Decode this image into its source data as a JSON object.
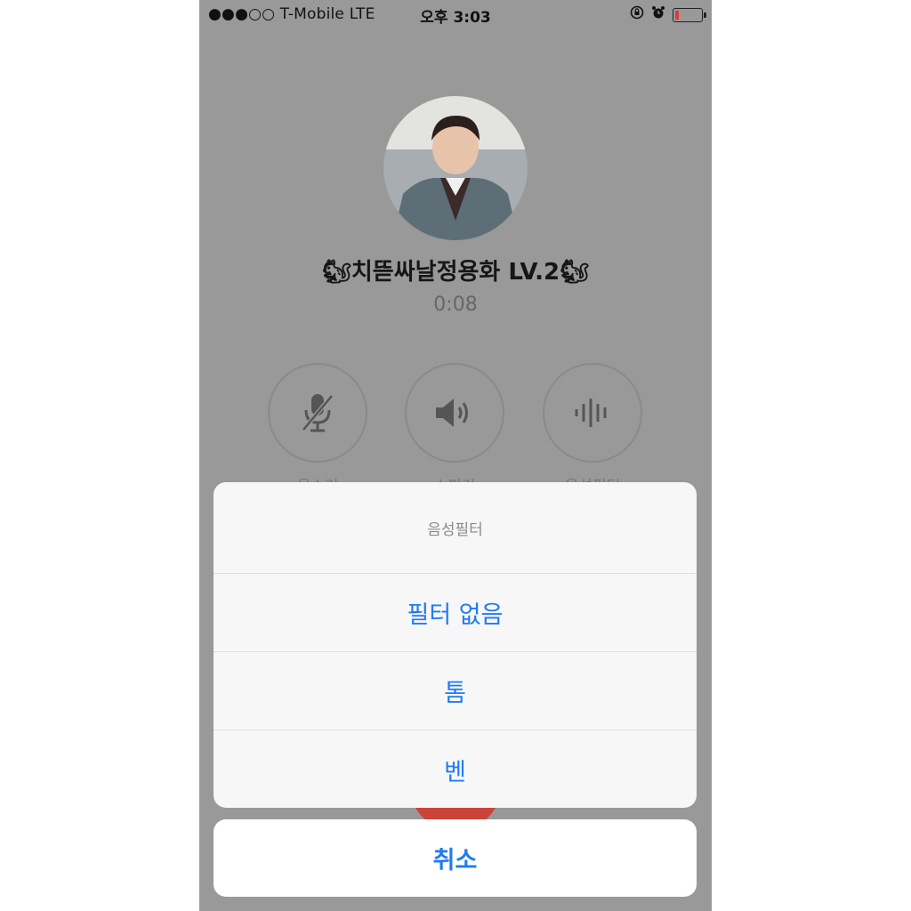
{
  "status_bar": {
    "signal_carrier": "●●●○○ T-Mobile   LTE",
    "time": "오후 3:03"
  },
  "call": {
    "name": "🐿치뜯싸날정용화 LV.2🐿",
    "duration": "0:08"
  },
  "controls": [
    {
      "icon": "mic-muted-icon",
      "label": "음소거"
    },
    {
      "icon": "speaker-icon",
      "label": "스피커"
    },
    {
      "icon": "voice-filter-icon",
      "label": "음성필터"
    }
  ],
  "action_sheet": {
    "title": "음성필터",
    "options": [
      "필터 없음",
      "톰",
      "벤"
    ],
    "cancel": "취소"
  },
  "colors": {
    "accent": "#1f7cf3",
    "dim_background": "#999999",
    "end_call": "#c9443b"
  }
}
